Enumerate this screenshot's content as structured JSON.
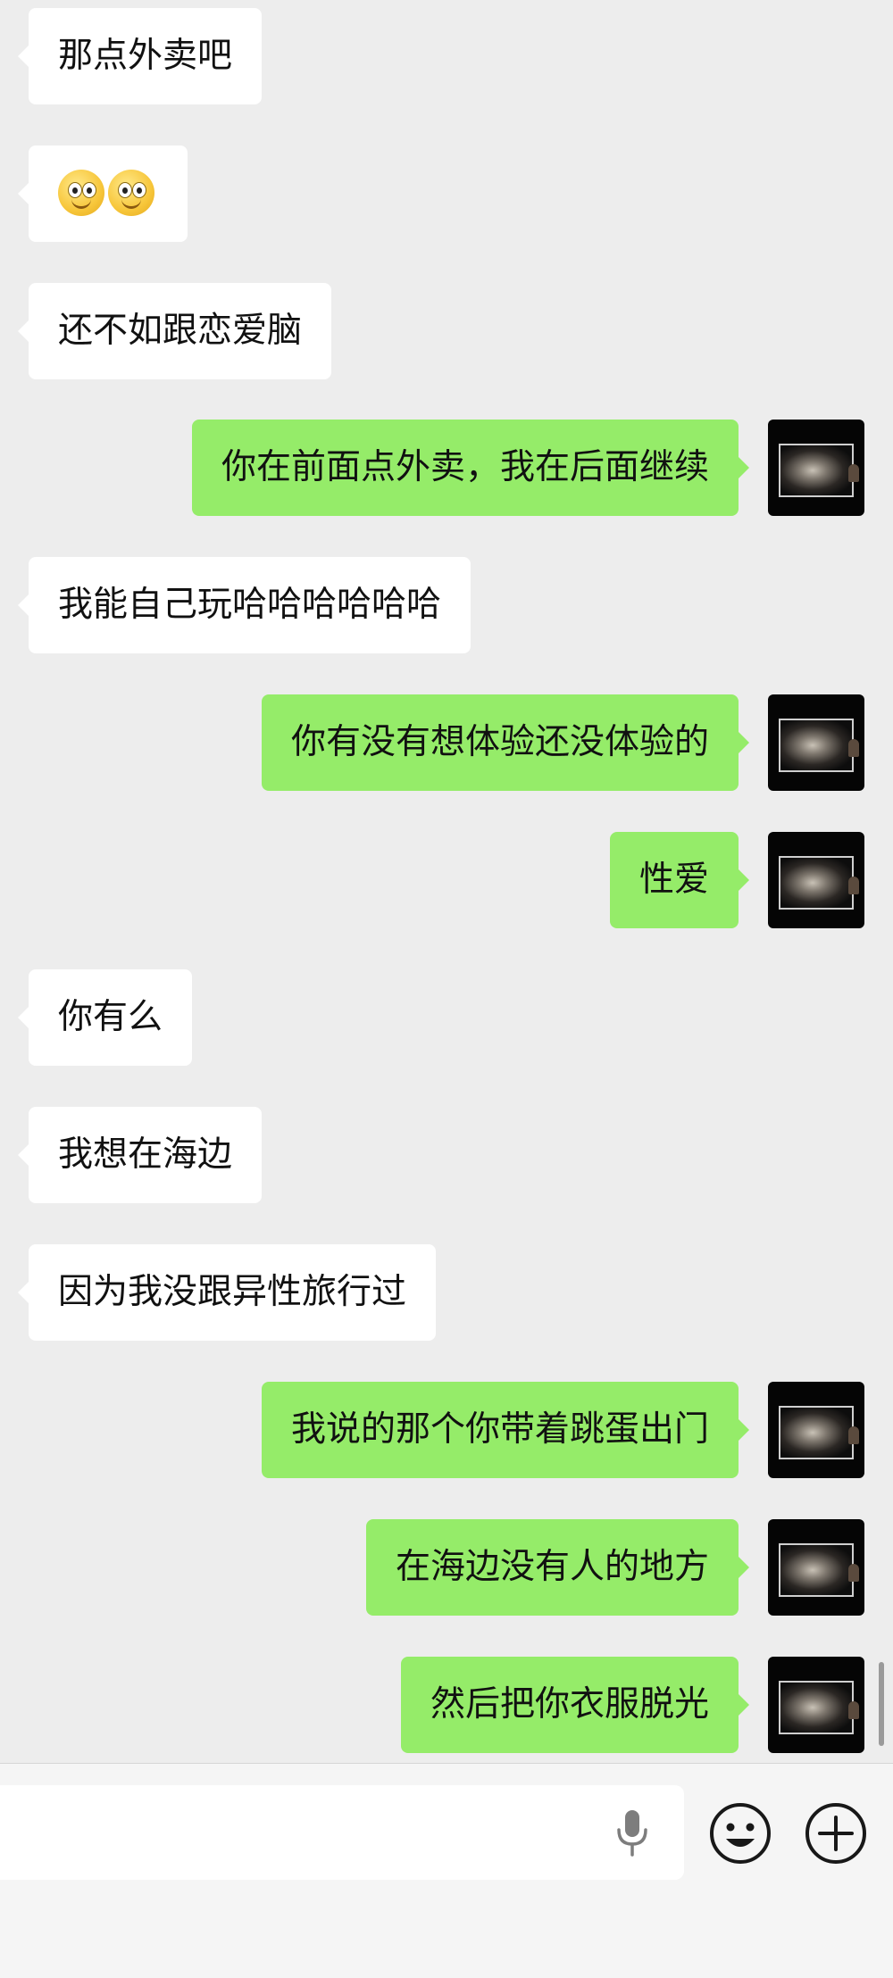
{
  "messages": [
    {
      "side": "in",
      "text": "那点外卖吧"
    },
    {
      "side": "in",
      "text": "",
      "emojis": [
        "slightly-smiling-face",
        "slightly-smiling-face"
      ]
    },
    {
      "side": "in",
      "text": "还不如跟恋爱脑"
    },
    {
      "side": "out",
      "text": "你在前面点外卖，我在后面继续"
    },
    {
      "side": "in",
      "text": "我能自己玩哈哈哈哈哈哈"
    },
    {
      "side": "out",
      "text": "你有没有想体验还没体验的"
    },
    {
      "side": "out",
      "text": "性爱"
    },
    {
      "side": "in",
      "text": "你有么"
    },
    {
      "side": "in",
      "text": "我想在海边"
    },
    {
      "side": "in",
      "text": "因为我没跟异性旅行过"
    },
    {
      "side": "out",
      "text": "我说的那个你带着跳蛋出门"
    },
    {
      "side": "out",
      "text": "在海边没有人的地方"
    },
    {
      "side": "out",
      "text": "然后把你衣服脱光"
    }
  ],
  "input": {
    "value": "",
    "voice_icon": "microphone-icon",
    "emoji_icon": "smiley-face-icon",
    "more_icon": "plus-circle-icon"
  },
  "colors": {
    "background": "#ededed",
    "incoming_bubble": "#ffffff",
    "outgoing_bubble": "#95ec69",
    "input_bar": "#f5f5f5"
  }
}
